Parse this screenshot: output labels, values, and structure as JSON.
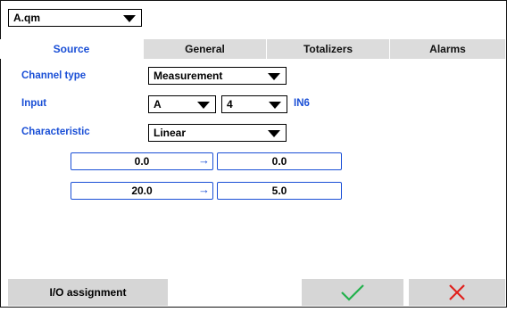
{
  "header": {
    "object_select": "A.qm"
  },
  "tabs": [
    {
      "label": "Source",
      "active": true
    },
    {
      "label": "General",
      "active": false
    },
    {
      "label": "Totalizers",
      "active": false
    },
    {
      "label": "Alarms",
      "active": false
    }
  ],
  "source": {
    "channel_type_label": "Channel type",
    "channel_type_value": "Measurement",
    "input_label": "Input",
    "input_slot_value": "A",
    "input_channel_value": "4",
    "input_io_name": "IN6",
    "characteristic_label": "Characteristic",
    "characteristic_value": "Linear",
    "mapping": [
      {
        "from": "0.0",
        "to": "0.0"
      },
      {
        "from": "20.0",
        "to": "5.0"
      }
    ],
    "arrow_glyph": "→"
  },
  "footer": {
    "io_assignment_label": "I/O assignment",
    "ok_icon": "check-icon",
    "cancel_icon": "close-icon"
  },
  "colors": {
    "accent": "#1a4fd6",
    "ok": "#22b14c",
    "cancel": "#e0201b",
    "tab_inactive": "#dcdcdc",
    "button": "#d6d6d6"
  }
}
